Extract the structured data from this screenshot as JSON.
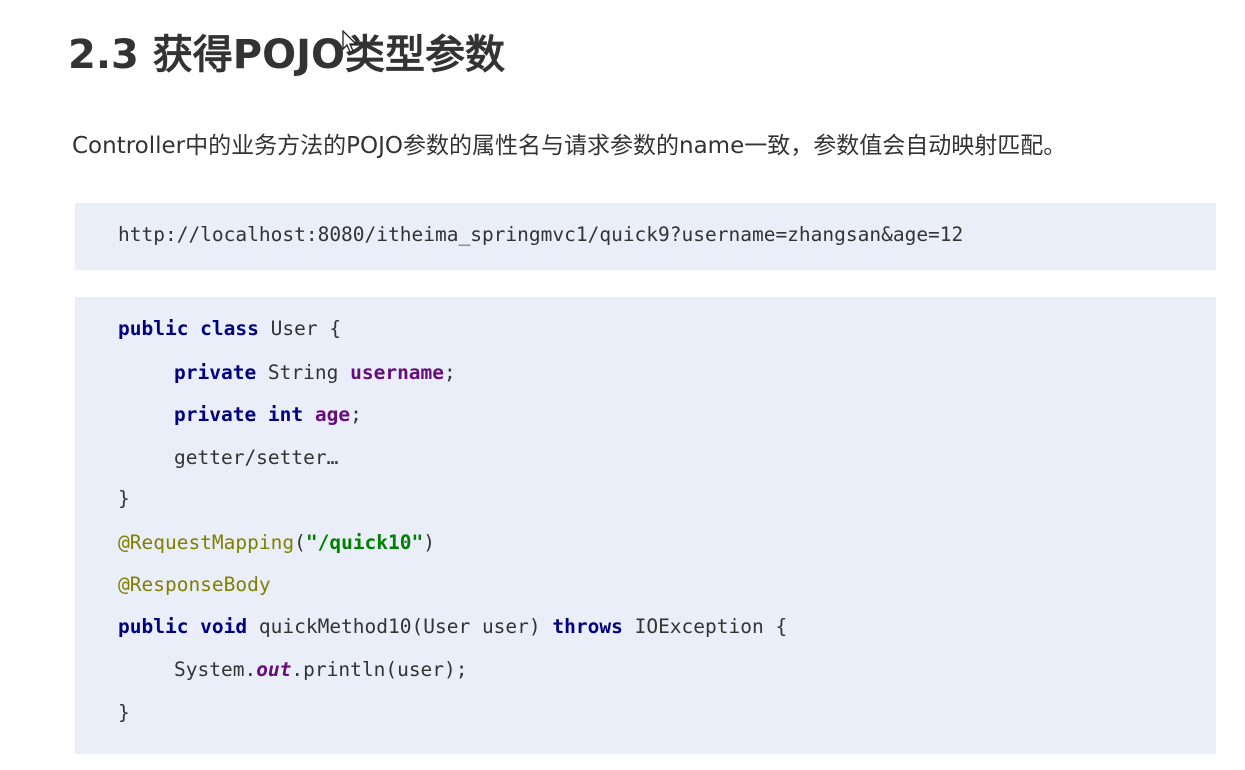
{
  "title": "2.3 获得POJO类型参数",
  "description": "Controller中的业务方法的POJO参数的属性名与请求参数的name一致，参数值会自动映射匹配。",
  "url_example": "http://localhost:8080/itheima_springmvc1/quick9?username=zhangsan&age=12",
  "code": {
    "l1_kw": "public class",
    "l1_rest": " User {",
    "l2_kw": "private",
    "l2_type": " String ",
    "l2_field": "username",
    "l2_end": ";",
    "l3_kw": "private int",
    "l3_sp": " ",
    "l3_field": "age",
    "l3_end": ";",
    "l4": "getter/setter…",
    "l5": "}",
    "l6_anno": "@RequestMapping",
    "l6_open": "(",
    "l6_str": "\"/quick10\"",
    "l6_close": ")",
    "l7_anno": "@ResponseBody",
    "l8_kw": "public void",
    "l8_mid": " quickMethod10(User user) ",
    "l8_kw2": "throws",
    "l8_end": " IOException {",
    "l9_a": "System.",
    "l9_field": "out",
    "l9_b": ".println(user);",
    "l10": "}"
  }
}
